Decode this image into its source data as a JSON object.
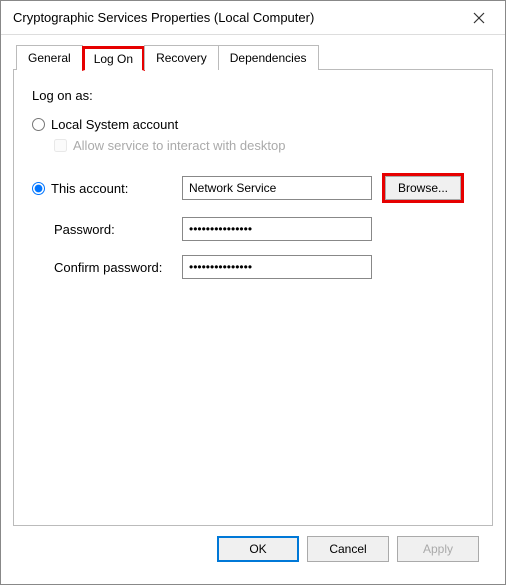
{
  "window": {
    "title": "Cryptographic Services Properties (Local Computer)"
  },
  "tabs": {
    "general": "General",
    "logon": "Log On",
    "recovery": "Recovery",
    "dependencies": "Dependencies"
  },
  "panel": {
    "log_on_as": "Log on as:",
    "local_system": "Local System account",
    "allow_interact": "Allow service to interact with desktop",
    "this_account": "This account:",
    "account_value": "Network Service",
    "browse": "Browse...",
    "password_label": "Password:",
    "password_value": "•••••••••••••••",
    "confirm_label": "Confirm password:",
    "confirm_value": "•••••••••••••••"
  },
  "footer": {
    "ok": "OK",
    "cancel": "Cancel",
    "apply": "Apply"
  }
}
